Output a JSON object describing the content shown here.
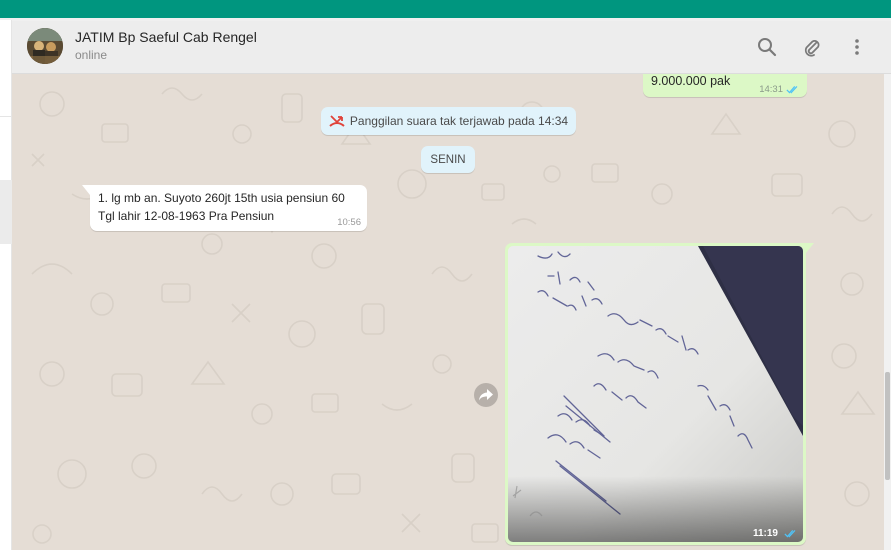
{
  "contact": {
    "name": "JATIM Bp Saeful Cab Rengel",
    "status": "online"
  },
  "header_icons": [
    "search-icon",
    "paperclip-icon",
    "menu-icon"
  ],
  "messages": {
    "outgoing_text": {
      "text": "9.000.000 pak",
      "time": "14:31"
    },
    "missed_call": {
      "text": "Panggilan suara tak terjawab pada 14:34"
    },
    "date_separator": "SENIN",
    "incoming": {
      "line1": "1. lg mb an. Suyoto 260jt 15th usia pensiun 60",
      "line2": "Tgl lahir 12-08-1963 Pra Pensiun",
      "time": "10:56"
    },
    "outgoing_image": {
      "time": "11:19"
    }
  },
  "colors": {
    "brand_teal": "#00967f",
    "chat_bg": "#e5ddd5",
    "outgoing_bubble": "#dcf8c6",
    "incoming_bubble": "#ffffff",
    "system_notice": "#e1f3fb",
    "missed_call_red": "#e0423a",
    "read_ticks": "#4fc3f7"
  }
}
